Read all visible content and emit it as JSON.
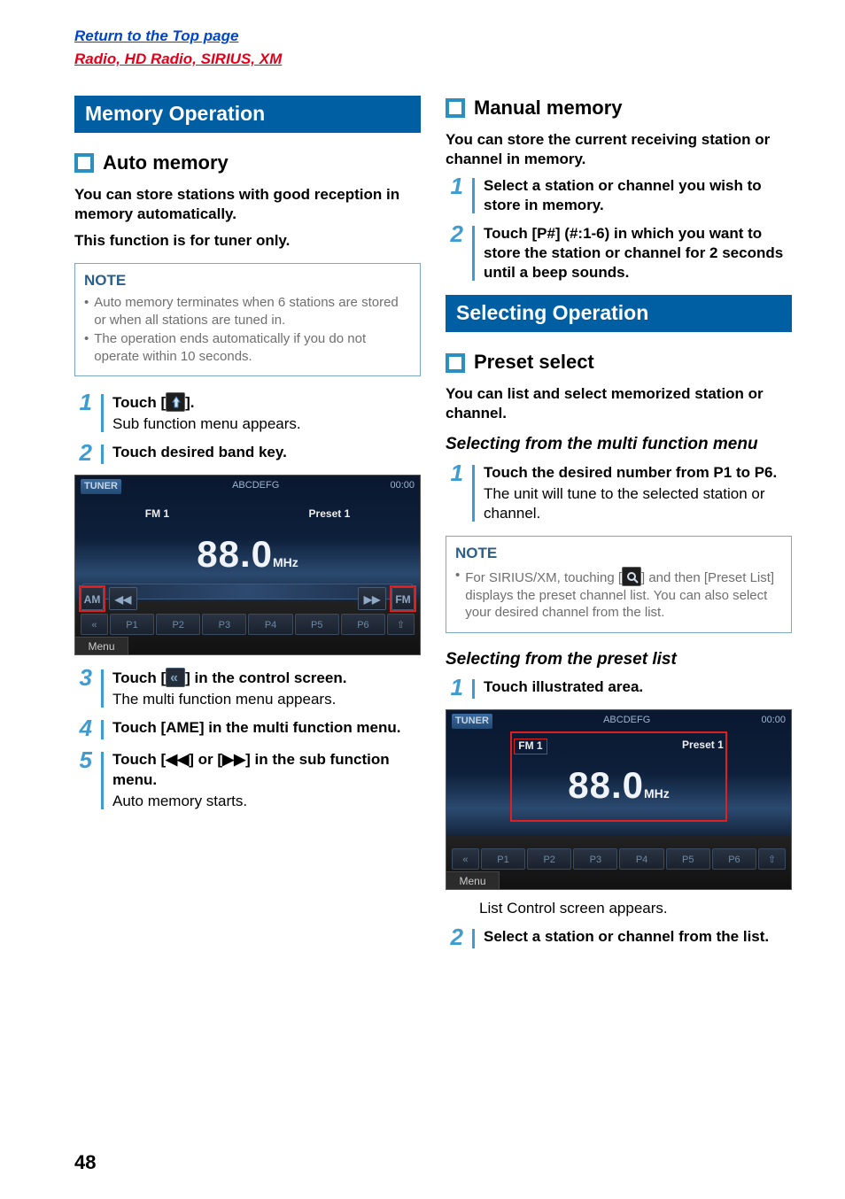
{
  "toplink1": "Return to the Top page",
  "toplink2": "Radio, HD Radio, SIRIUS, XM",
  "pagenum": "48",
  "left": {
    "h1": "Memory Operation",
    "h2": "Auto memory",
    "intro1": "You can store stations with good reception in memory automatically.",
    "intro2": "This function is for tuner only.",
    "note_label": "NOTE",
    "note1": "Auto memory terminates when 6 stations are stored or when all stations are tuned in.",
    "note2": "The operation ends automatically if you do not operate within 10 seconds.",
    "step1_num": "1",
    "step1_bold_a": "Touch [",
    "step1_bold_b": "].",
    "step1_sub": "Sub function menu appears.",
    "step2_num": "2",
    "step2_bold": "Touch desired band key.",
    "step3_num": "3",
    "step3_bold_a": "Touch [",
    "step3_bold_b": "] in the control screen.",
    "step3_sub": "The multi function menu appears.",
    "step4_num": "4",
    "step4_bold": "Touch [AME] in the multi function menu.",
    "step5_num": "5",
    "step5_bold": "Touch [◀◀] or [▶▶] in the sub function menu.",
    "step5_sub": "Auto memory starts."
  },
  "right": {
    "h2a": "Manual memory",
    "introA": "You can store the current receiving station or channel in memory.",
    "stepA1_num": "1",
    "stepA1_bold": "Select a station or channel you wish to store in memory.",
    "stepA2_num": "2",
    "stepA2_bold": "Touch [P#] (#:1-6) in which you want to store the station or channel for 2 seconds until a beep sounds.",
    "h1b": "Selecting Operation",
    "h2b": "Preset select",
    "introB": "You can list and select memorized station or channel.",
    "h3a": "Selecting from the multi function menu",
    "stepB1_num": "1",
    "stepB1_bold": "Touch the desired number from P1 to P6.",
    "stepB1_sub": "The unit will tune to the selected station or channel.",
    "noteB_label": "NOTE",
    "noteB_a": "For SIRIUS/XM, touching [",
    "noteB_b": "] and then [Preset List] displays the preset channel list. You can also select your desired channel from the list.",
    "h3b": "Selecting from the preset list",
    "stepC1_num": "1",
    "stepC1_bold": "Touch illustrated area.",
    "stepC1_sub": "List Control screen appears.",
    "stepC2_num": "2",
    "stepC2_bold": "Select a station or channel from the list."
  },
  "ss": {
    "tuner": "TUNER",
    "abcdefg": "ABCDEFG",
    "time": "00:00",
    "fm1": "FM 1",
    "preset1": "Preset 1",
    "freq": "88.0",
    "mhz": "MHz",
    "am": "AM",
    "fm": "FM",
    "ll": "◀◀",
    "rr": "▶▶",
    "p1": "P1",
    "p2": "P2",
    "p3": "P3",
    "p4": "P4",
    "p5": "P5",
    "p6": "P6",
    "chev": "«",
    "pin": "⇧",
    "menu": "Menu"
  }
}
